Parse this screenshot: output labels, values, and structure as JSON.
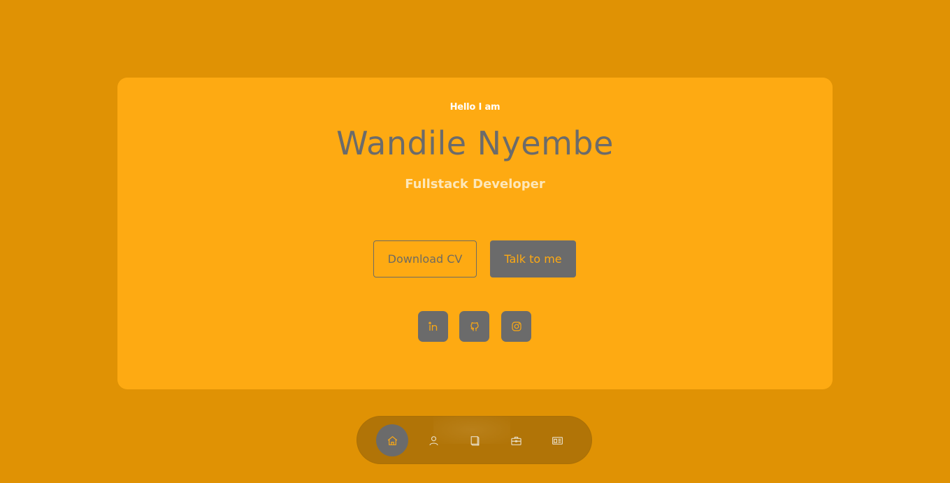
{
  "hero": {
    "greeting": "Hello I am",
    "name": "Wandile Nyembe",
    "role": "Fullstack Developer"
  },
  "actions": {
    "download_cv": "Download CV",
    "talk": "Talk to me"
  },
  "socials": [
    {
      "icon": "linkedin-icon"
    },
    {
      "icon": "github-icon"
    },
    {
      "icon": "instagram-icon"
    }
  ],
  "nav": {
    "items": [
      {
        "icon": "home-icon",
        "active": true
      },
      {
        "icon": "user-icon",
        "active": false
      },
      {
        "icon": "book-icon",
        "active": false
      },
      {
        "icon": "briefcase-icon",
        "active": false
      },
      {
        "icon": "message-icon",
        "active": false
      }
    ]
  },
  "colors": {
    "page_background": "#e09204",
    "card_background": "#feaa12",
    "accent_gray": "#6b6b6b",
    "role_text": "#fde7b9"
  }
}
